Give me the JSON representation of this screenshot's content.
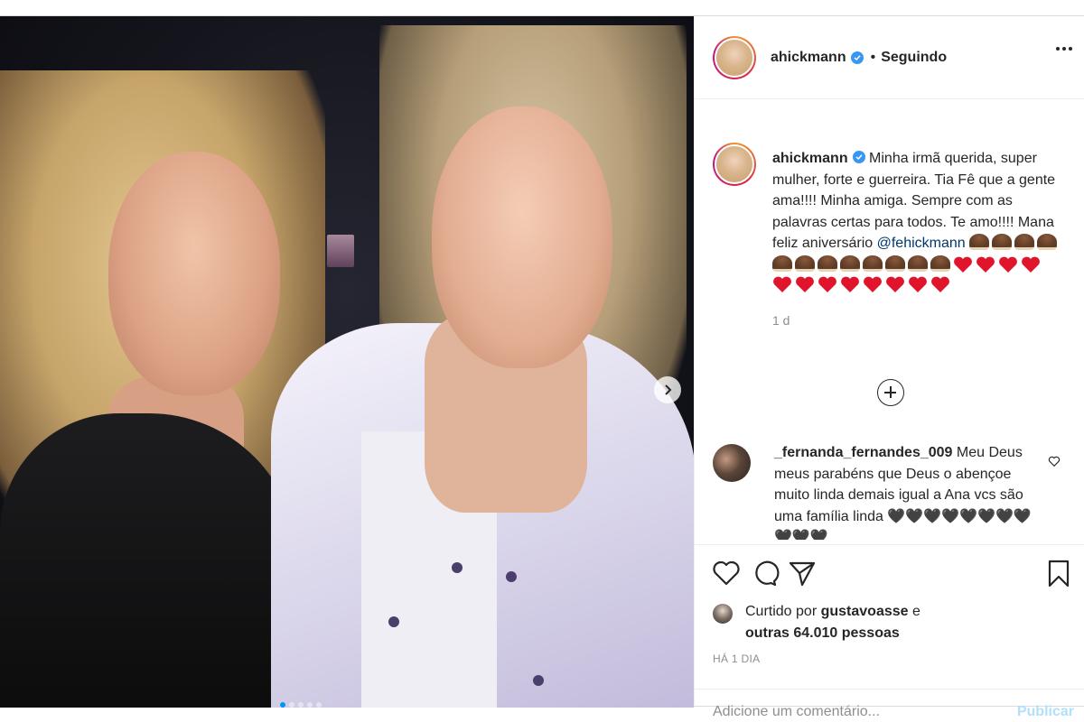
{
  "post": {
    "username": "ahickmann",
    "follow_status": "Seguindo",
    "separator": "•",
    "caption": {
      "text_before_mention": "Minha irmã querida, super mulher, forte e guerreira. Tia Fê que a gente ama!!!! Minha amiga. Sempre com as palavras certas para todos. Te amo!!!! Mana feliz aniversário",
      "mention": "@fehickmann",
      "emoji_summary": "🥞🥞🥞🥞🥞🥞🥞🥞🥞🥞🥞🥞❤❤❤❤❤❤❤❤❤❤❤❤",
      "time": "1 d"
    },
    "comment": {
      "username": "_fernanda_fernandes_009",
      "text": "Meu Deus meus parabéns que Deus o abençoe muito linda demais igual a Ana vcs são uma família linda",
      "emoji_summary": "🖤🖤🖤🖤🖤🖤🖤🖤🖤🖤🖤"
    },
    "likes": {
      "prefix": "Curtido por",
      "liker": "gustavoasse",
      "connector": "e",
      "others": "outras 64.010 pessoas"
    },
    "posted_ago": "HÁ 1 DIA",
    "add_comment": {
      "placeholder": "Adicione um comentário...",
      "publish_label": "Publicar"
    }
  },
  "icons": {
    "verified": "verified-badge-icon",
    "more": "more-options-icon",
    "next": "chevron-right-icon",
    "load_more": "plus-circle-icon",
    "like": "heart-icon",
    "comment": "comment-icon",
    "share": "paper-plane-icon",
    "save": "bookmark-icon"
  },
  "colors": {
    "verified": "#3897f0",
    "link": "#00376b",
    "secondary_text": "#8e8e8e",
    "publish_disabled": "#b2dffc"
  }
}
